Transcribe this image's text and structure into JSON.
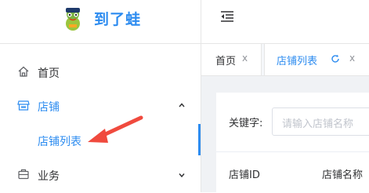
{
  "brand": {
    "name": "到了蛙",
    "accent": "#2d8cf0"
  },
  "sidebar": {
    "items": [
      {
        "label": "首页",
        "icon": "home-icon"
      },
      {
        "label": "店铺",
        "icon": "shop-icon",
        "expanded": true,
        "children": [
          {
            "label": "店铺列表",
            "active": true
          }
        ]
      },
      {
        "label": "业务",
        "icon": "briefcase-icon",
        "expanded": false
      }
    ]
  },
  "header": {
    "fold_icon": "menu-fold-icon"
  },
  "tabs": [
    {
      "label": "首页",
      "close": "x"
    },
    {
      "label": "店铺列表",
      "close": "x",
      "active": true
    }
  ],
  "search": {
    "label": "关键字:",
    "placeholder": "请输入店铺名称"
  },
  "table": {
    "columns": [
      "店铺ID",
      "店铺名称"
    ]
  },
  "annotation": {
    "color": "#f04a3e"
  }
}
